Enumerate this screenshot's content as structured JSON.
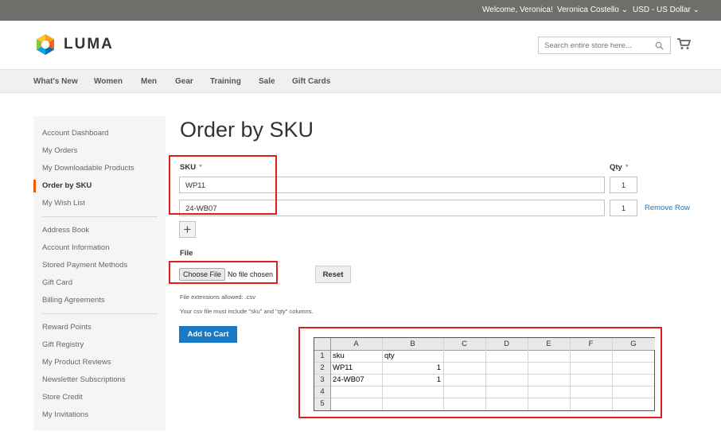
{
  "topbar": {
    "welcome": "Welcome, Veronica!",
    "account": "Veronica Costello",
    "currency": "USD - US Dollar"
  },
  "brand": {
    "name": "LUMA"
  },
  "search": {
    "placeholder": "Search entire store here..."
  },
  "nav": [
    "What's New",
    "Women",
    "Men",
    "Gear",
    "Training",
    "Sale",
    "Gift Cards"
  ],
  "sidebar": {
    "group1": [
      "Account Dashboard",
      "My Orders",
      "My Downloadable Products",
      "Order by SKU",
      "My Wish List"
    ],
    "group2": [
      "Address Book",
      "Account Information",
      "Stored Payment Methods",
      "Gift Card",
      "Billing Agreements"
    ],
    "group3": [
      "Reward Points",
      "Gift Registry",
      "My Product Reviews",
      "Newsletter Subscriptions",
      "Store Credit",
      "My Invitations"
    ],
    "active": "Order by SKU"
  },
  "page": {
    "title": "Order by SKU",
    "sku_label": "SKU",
    "qty_label": "Qty",
    "required_mark": "*",
    "rows": [
      {
        "sku": "WP11",
        "qty": "1"
      },
      {
        "sku": "24-WB07",
        "qty": "1"
      }
    ],
    "remove_row": "Remove Row",
    "add_row": "+",
    "file_label": "File",
    "choose_file": "Choose File",
    "no_file": "No file chosen",
    "reset": "Reset",
    "file_ext_note": "File extensions allowed: .csv",
    "csv_note": "Your csv file must include \"sku\" and \"qty\" columns.",
    "add_to_cart": "Add to Cart"
  },
  "spreadsheet": {
    "columns": [
      "A",
      "B",
      "C",
      "D",
      "E",
      "F",
      "G"
    ],
    "row_numbers": [
      "1",
      "2",
      "3",
      "4",
      "5"
    ],
    "cells": {
      "A1": "sku",
      "B1": "qty",
      "A2": "WP11",
      "B2": "1",
      "A3": "24-WB07",
      "B3": "1"
    }
  },
  "colors": {
    "accent": "#1979c3",
    "highlight": "#e01e1e",
    "active_marker": "#ff5501",
    "topbar": "#6e6f6a"
  }
}
